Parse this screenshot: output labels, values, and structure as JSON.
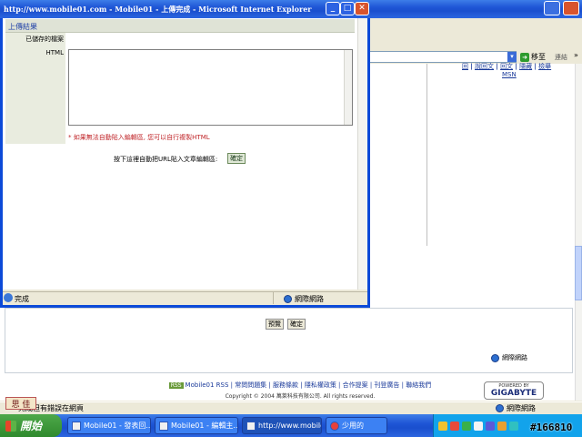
{
  "popup": {
    "title": "http://www.mobile01.com - Mobile01 - 上傳完成 - Microsoft Internet Explorer",
    "header": "上傳結果",
    "saved_file_label": "已儲存的檔案",
    "html_label": "HTML",
    "html_value": "",
    "warning": "* 如果無法自動貼入編輯區, 您可以自行複製HTML",
    "paste_prompt": "按下這裡自動把URL貼入文章編輯區:",
    "ok_button": "確定",
    "status_text": "完成",
    "zone_text": "網際網路"
  },
  "background": {
    "go_label": "移至",
    "links_label": "連結",
    "chevrons": "»",
    "right_links": [
      "回",
      "|",
      "說回文",
      "|",
      "回文",
      "|",
      "隱藏",
      "|",
      "檢舉"
    ],
    "msn": "MSN",
    "preview_button": "預覽",
    "confirm_button": "確定",
    "frame_zone": "網際網路",
    "footer_links": "Mobile01 RSS | 常問問題集 | 服務條款 | 隱私權政策 | 合作提案 | 刊登廣告 | 聯絡我們",
    "rss_badge": "RSS",
    "copyright": "Copyright © 2004 萬萊科技有限公司. All rights reserved.",
    "gigabyte_powered": "POWERED BY",
    "gigabyte_name": "GIGABYTE",
    "status_text": "完成但有錯誤在網頁",
    "zone_text": "網際網路",
    "side_tab": "思 佳"
  },
  "taskbar": {
    "start_label": "開始",
    "tasks": [
      "Mobile01 - 發表回...",
      "Mobile01 - 編輯主...",
      "http://www.mobile01...",
      "少用的"
    ],
    "watermark": "#166810"
  }
}
